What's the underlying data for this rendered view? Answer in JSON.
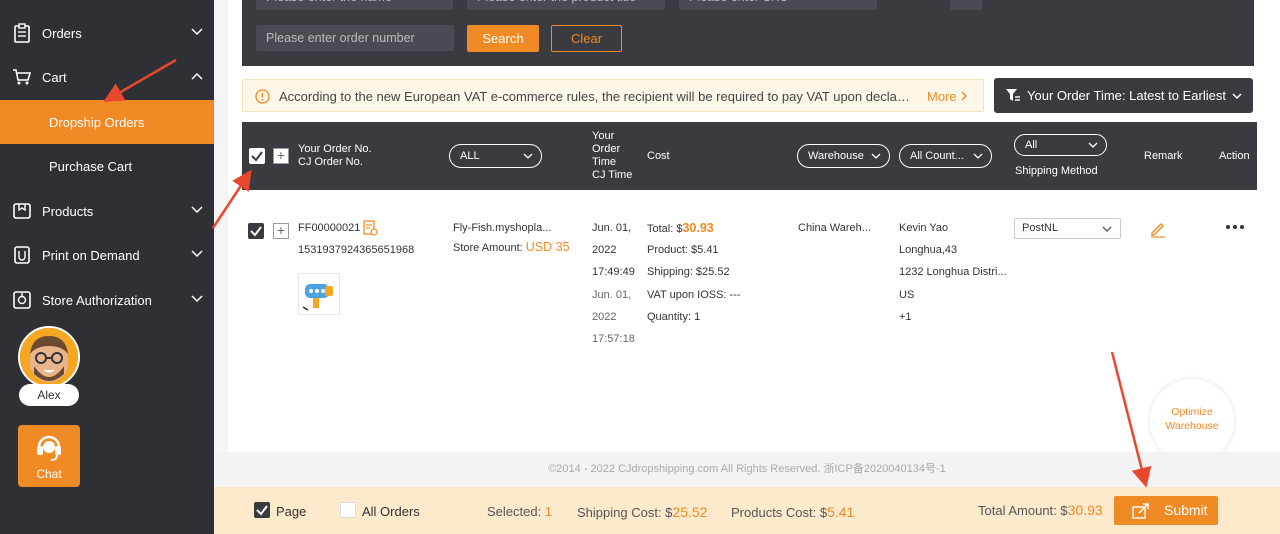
{
  "sidebar": {
    "items": [
      {
        "label": "Orders",
        "icon": "clipboard-icon"
      },
      {
        "label": "Cart",
        "icon": "cart-icon"
      },
      {
        "label": "Products",
        "icon": "box-icon"
      },
      {
        "label": "Print on Demand",
        "icon": "print-icon"
      },
      {
        "label": "Store Authorization",
        "icon": "store-icon"
      }
    ],
    "sub_items": [
      {
        "label": "Dropship Orders",
        "active": true
      },
      {
        "label": "Purchase Cart",
        "active": false
      }
    ],
    "user_name": "Alex",
    "chat_label": "Chat"
  },
  "filters": {
    "name_placeholder": "Please enter the name",
    "product_placeholder": "Please enter the product title",
    "sku_placeholder": "Please enter SKU",
    "order_placeholder": "Please enter order number",
    "search_label": "Search",
    "clear_label": "Clear"
  },
  "notice": {
    "text": "According to the new European VAT e-commerce rules, the recipient will be required to pay VAT upon declaration of goods",
    "more_label": "More"
  },
  "sort": {
    "label": "Your Order Time: Latest to Earliest"
  },
  "table": {
    "headers": {
      "order_no": "Your Order No.",
      "cj_order_no": "CJ Order No.",
      "store_filter": "ALL",
      "order_time_1": "Your",
      "order_time_2": "Order",
      "order_time_3": "Time",
      "cj_time": "CJ Time",
      "cost": "Cost",
      "warehouse_filter": "Warehouse",
      "country_filter": "All Count...",
      "shipping_filter": "All",
      "shipping_method": "Shipping Method",
      "remark": "Remark",
      "action": "Action"
    },
    "row": {
      "order_no": "FF00000021",
      "cj_order_no": "1531937924365651968",
      "store": "Fly-Fish.myshopla...",
      "store_amount_label": "Store Amount:",
      "store_amount_value": "USD 35",
      "order_date": "Jun. 01,",
      "order_year": "2022",
      "order_time": "17:49:49",
      "cj_date": "Jun. 01,",
      "cj_year": "2022",
      "cj_time": "17:57:18",
      "total_label": "Total: $",
      "total_value": "30.93",
      "product_cost": "Product: $5.41",
      "shipping_cost": "Shipping: $25.52",
      "vat": "VAT upon IOSS: ---",
      "quantity": "Quantity: 1",
      "warehouse": "China Wareh...",
      "customer_name": "Kevin Yao",
      "address1": "Longhua,43",
      "address2": "1232 Longhua Distri...",
      "country": "US",
      "phone": "+1",
      "shipping_method": "PostNL"
    }
  },
  "footer": {
    "copyright": "©2014 - 2022 CJdropshipping.com All Rights Reserved. 浙ICP备2020040134号-1"
  },
  "optimize": {
    "line1": "Optimize",
    "line2": "Warehouse"
  },
  "bottom_bar": {
    "page_label": "Page",
    "all_orders_label": "All Orders",
    "selected_label": "Selected:",
    "selected_value": "1",
    "shipping_label": "Shipping Cost: $",
    "shipping_value": "25.52",
    "products_label": "Products Cost: $",
    "products_value": "5.41",
    "total_label": "Total Amount: $",
    "total_value": "30.93",
    "submit_label": "Submit"
  },
  "colors": {
    "accent": "#f08a24",
    "sidebar": "#2f3036",
    "arrow": "#e8492e"
  }
}
